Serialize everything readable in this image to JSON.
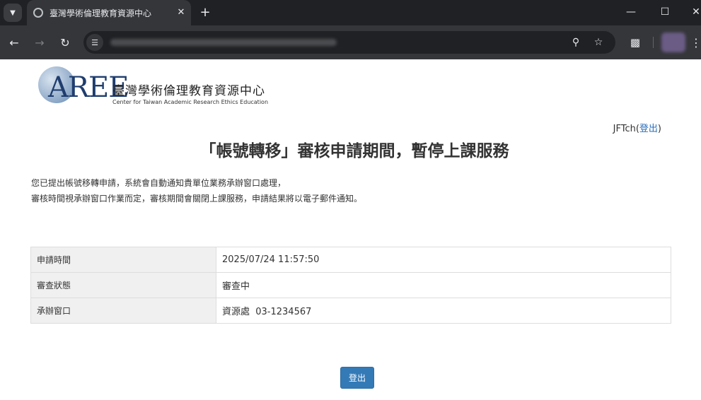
{
  "browser": {
    "tab_title": "臺灣學術倫理教育資源中心",
    "tab_menu_icon": "chevron-down-icon",
    "tab_close_icon": "close-icon",
    "new_tab_icon": "plus-icon",
    "url": "",
    "icons": [
      "back-icon",
      "forward-icon",
      "reload-icon",
      "site-info-icon",
      "zoom-icon",
      "star-icon",
      "extensions-icon",
      "profile-avatar",
      "kebab-menu-icon"
    ]
  },
  "site": {
    "logo_mark": "AREE",
    "logo_name_cn": "臺灣學術倫理教育資源中心",
    "logo_name_en": "Center for Taiwan Academic Research Ethics Education"
  },
  "user": {
    "name": "JFTch",
    "open_paren": "(",
    "logout_link": "登出",
    "close_paren": ")"
  },
  "page": {
    "heading": "「帳號轉移」審核申請期間，暫停上課服務",
    "notice_line1": "您已提出帳號移轉申請，系統會自動通知貴單位業務承辦窗口處理，",
    "notice_line2": "審核時間視承辦窗口作業而定，審核期間會關閉上課服務，申請結果將以電子郵件通知。"
  },
  "table": {
    "rows": [
      {
        "label": "申請時間",
        "value": "2025/07/24 11:57:50"
      },
      {
        "label": "審查狀態",
        "value": "審查中"
      },
      {
        "label": "承辦窗口",
        "value": "資源處  03-1234567"
      }
    ]
  },
  "actions": {
    "logout_button": "登出"
  },
  "colors": {
    "link": "#2a6ebb",
    "primary_button": "#337ab7",
    "table_key_bg": "#f0f0f0",
    "browser_chrome": "#35363a"
  }
}
